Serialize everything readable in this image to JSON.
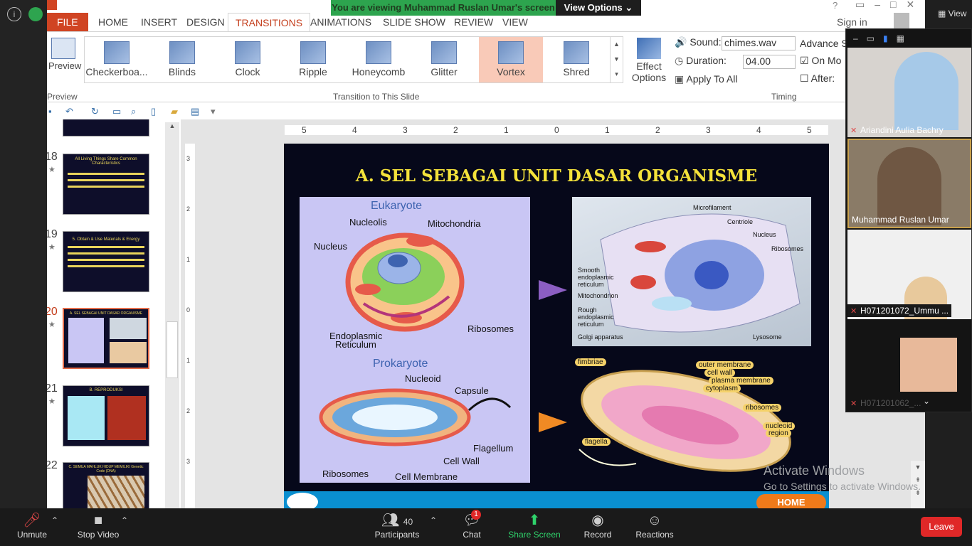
{
  "share_banner": {
    "text": "You are viewing Muhammad Ruslan Umar's screen",
    "view_options": "View Options"
  },
  "ribbon": {
    "tabs": [
      "FILE",
      "HOME",
      "INSERT",
      "DESIGN",
      "TRANSITIONS",
      "ANIMATIONS",
      "SLIDE SHOW",
      "REVIEW",
      "VIEW"
    ],
    "active_tab": "TRANSITIONS",
    "sign_in": "Sign in",
    "preview_label": "Preview",
    "preview_group": "Preview",
    "gallery_group": "Transition to This Slide",
    "transitions": [
      "Checkerboa...",
      "Blinds",
      "Clock",
      "Ripple",
      "Honeycomb",
      "Glitter",
      "Vortex",
      "Shred"
    ],
    "selected_transition": "Vortex",
    "effect_options_1": "Effect",
    "effect_options_2": "Options",
    "sound_label": "Sound:",
    "sound_value": "chimes.wav",
    "duration_label": "Duration:",
    "duration_value": "04.00",
    "apply_all": "Apply To All",
    "advance_label": "Advance S",
    "on_mouse": "On Mo",
    "after": "After:",
    "timing_group": "Timing"
  },
  "ruler": {
    "h_ticks": [
      "5",
      "4",
      "3",
      "2",
      "1",
      "0",
      "1",
      "2",
      "3",
      "4",
      "5"
    ],
    "v_ticks": [
      "3",
      "2",
      "1",
      "0",
      "1",
      "2",
      "3"
    ]
  },
  "thumbnails": [
    {
      "num": "18",
      "title": "All Living Things Share Common Characteristics",
      "selected": false
    },
    {
      "num": "19",
      "title": "5. Obtain & Use Materials & Energy",
      "selected": false
    },
    {
      "num": "20",
      "title": "A. SEL SEBAGAI UNIT DASAR ORGANISME",
      "selected": true
    },
    {
      "num": "21",
      "title": "B. REPRODUKSI",
      "selected": false
    },
    {
      "num": "22",
      "title": "C. SEMUA MAHLUK HIDUP MEMILIKI Genetic Code (DNA)",
      "selected": false
    }
  ],
  "slide": {
    "title": "A. SEL SEBAGAI UNIT DASAR ORGANISME",
    "eukaryote": "Eukaryote",
    "prokaryote": "Prokaryote",
    "euk_labels": [
      "Nucleolis",
      "Mitochondria",
      "Nucleus",
      "Ribosomes",
      "Endoplasmic",
      "Reticulum"
    ],
    "prok_labels": [
      "Nucleoid",
      "Capsule",
      "Flagellum",
      "Cell Wall",
      "Ribosomes",
      "Cell Membrane"
    ],
    "animal_labels": [
      "Microfilament",
      "Centriole",
      "Nucleus",
      "Ribosomes",
      "Smooth",
      "endoplasmic",
      "reticulum",
      "Mitochondrion",
      "Rough",
      "endoplasmic",
      "reticulum",
      "Golgi apparatus",
      "Lysosome"
    ],
    "bact_labels": [
      "fimbriae",
      "outer membrane",
      "cell wall",
      "plasma membrane",
      "cytoplasm",
      "ribosomes",
      "nucleoid",
      "region",
      "flagella"
    ],
    "footer_home": "HOME"
  },
  "participants": [
    {
      "name": "Ariandini Aulia Bachry",
      "muted": true
    },
    {
      "name": "Muhammad Ruslan Umar",
      "muted": false
    },
    {
      "name": "H071201072_Ummu ...",
      "muted": true
    },
    {
      "name": "H071201062_...",
      "muted": true
    }
  ],
  "gallery_view_label": "View",
  "activate_windows": "Activate Windows",
  "activate_windows_sub": "Go to Settings to activate Windows.",
  "toolbar": {
    "unmute": "Unmute",
    "stop_video": "Stop Video",
    "participants": "Participants",
    "participants_count": "40",
    "chat": "Chat",
    "chat_badge": "1",
    "share_screen": "Share Screen",
    "record": "Record",
    "reactions": "Reactions",
    "leave": "Leave"
  }
}
